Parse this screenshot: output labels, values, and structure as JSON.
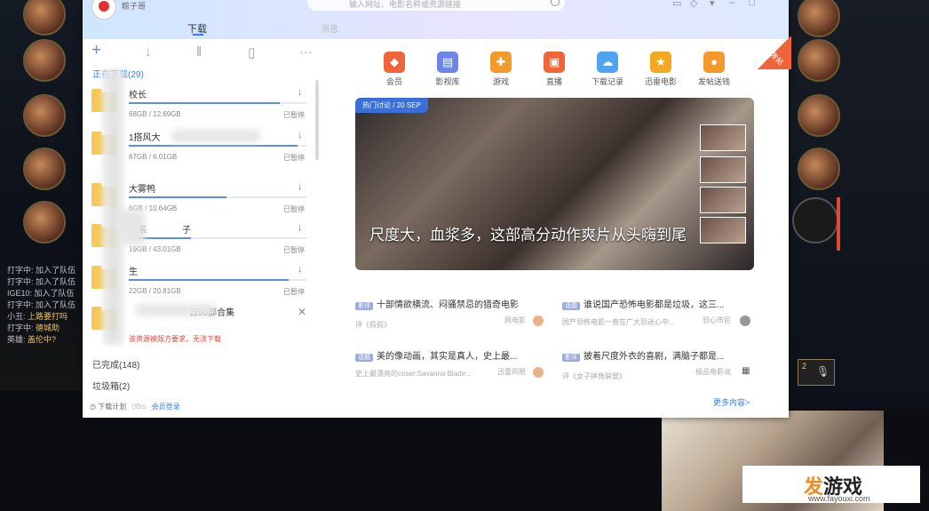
{
  "app": {
    "username": "粽子哥",
    "search_placeholder": "输入网址、电影名称或资源链接",
    "tab_download": "下载",
    "tab_second": "消息"
  },
  "left_panel": {
    "downloading_label": "正在下载(29)",
    "completed_label": "已完成(148)",
    "trash_label": "垃圾箱(2)",
    "schedule_label": "下载计划",
    "speed": "0B/s",
    "vip_label": "会员登录",
    "error_text": "该资源被版方要求，无法下载",
    "items": [
      {
        "name": "校长",
        "size": "68GB / 12.69GB",
        "status": "已暂停",
        "progress": 0.85
      },
      {
        "name": "1搭风大",
        "size": "67GB / 6.01GB",
        "status": "已暂停",
        "progress": 0.95
      },
      {
        "name": "大雾鸭",
        "size": "6GB / 10.64GB",
        "status": "已暂停",
        "progress": 0.55
      },
      {
        "name": "广东",
        "name2": "子",
        "size": "19GB / 43.01GB",
        "status": "已暂停",
        "progress": 0.35
      },
      {
        "name": "生",
        "size": "22GB / 20.81GB",
        "status": "已暂停",
        "progress": 0.9
      },
      {
        "name": "日50部合集",
        "size": "",
        "status": "",
        "progress": 0
      }
    ]
  },
  "nav": [
    {
      "label": "会员",
      "icon": "diamond-icon",
      "color": "#f0643a"
    },
    {
      "label": "影视库",
      "icon": "film-library-icon",
      "color": "#6d86e6"
    },
    {
      "label": "游戏",
      "icon": "gamepad-icon",
      "color": "#f39a2a"
    },
    {
      "label": "直播",
      "icon": "tv-icon",
      "color": "#f0643a"
    },
    {
      "label": "下载记录",
      "icon": "cloud-icon",
      "color": "#4fa3f0"
    },
    {
      "label": "迅雷电影",
      "icon": "movie-clap-icon",
      "color": "#f2a91f"
    },
    {
      "label": "发帖送钱",
      "icon": "coin-icon",
      "color": "#f39a2a"
    }
  ],
  "corner_badge": "我要发帖",
  "banner": {
    "tag": "热门讨论 / 20 SEP",
    "title": "尺度大，血浆多，这部高分动作爽片从头嗨到尾"
  },
  "news": [
    {
      "tag": "影评",
      "title": "十部情欲横流、闷骚禁忌的猎奇电影",
      "meta": "评《假假》",
      "author": "网电影"
    },
    {
      "tag": "话题",
      "title": "谁说国产恐怖电影都是垃圾，这三...",
      "meta": "国产恐怖电影一直在广大恐迷心中...",
      "author": "恐心市民"
    },
    {
      "tag": "话题",
      "title": "美的像动画，其实是真人，史上最...",
      "meta": "史上最漂亮的coser:Savanna Blade...",
      "author": "迅雷风眼"
    },
    {
      "tag": "影评",
      "title": "披着尺度外衣的喜剧，满脑子都是...",
      "meta": "评《女子摔角联盟》",
      "author": "极品电影说"
    }
  ],
  "more_label": "更多内容>",
  "watermark": {
    "brand_a": "发",
    "brand_b": "游戏",
    "url": "www.fayouxi.com"
  },
  "chat": [
    {
      "user": "打字中",
      "text": "加入了队伍"
    },
    {
      "user": "打字中",
      "text": "加入了队伍"
    },
    {
      "user": "IGE10",
      "text": "加入了队伍"
    },
    {
      "user": "打字中",
      "text": "加入了队伍"
    },
    {
      "user": "小丑",
      "text": "上路要打吗"
    },
    {
      "user": "打字中",
      "text": "德城助"
    },
    {
      "user": "英雄",
      "text": "盖伦中?"
    }
  ],
  "mic_count": "2"
}
